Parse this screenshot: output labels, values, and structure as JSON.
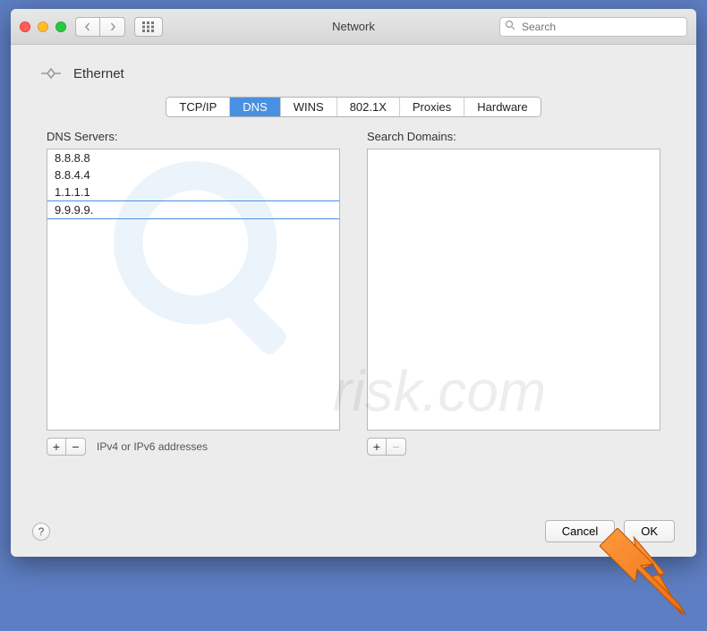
{
  "window": {
    "title": "Network",
    "search_placeholder": "Search"
  },
  "header": {
    "ethernet_label": "Ethernet"
  },
  "tabs": [
    {
      "label": "TCP/IP",
      "active": false
    },
    {
      "label": "DNS",
      "active": true
    },
    {
      "label": "WINS",
      "active": false
    },
    {
      "label": "802.1X",
      "active": false
    },
    {
      "label": "Proxies",
      "active": false
    },
    {
      "label": "Hardware",
      "active": false
    }
  ],
  "dns": {
    "label": "DNS Servers:",
    "servers": [
      "8.8.8.8",
      "8.8.4.4",
      "1.1.1.1",
      "9.9.9.9"
    ],
    "editing_index": 3,
    "footer_label": "IPv4 or IPv6 addresses"
  },
  "search_domains": {
    "label": "Search Domains:",
    "items": []
  },
  "buttons": {
    "help": "?",
    "cancel": "Cancel",
    "ok": "OK",
    "plus": "+",
    "minus": "−"
  },
  "watermark": {
    "text": "risk.com"
  }
}
